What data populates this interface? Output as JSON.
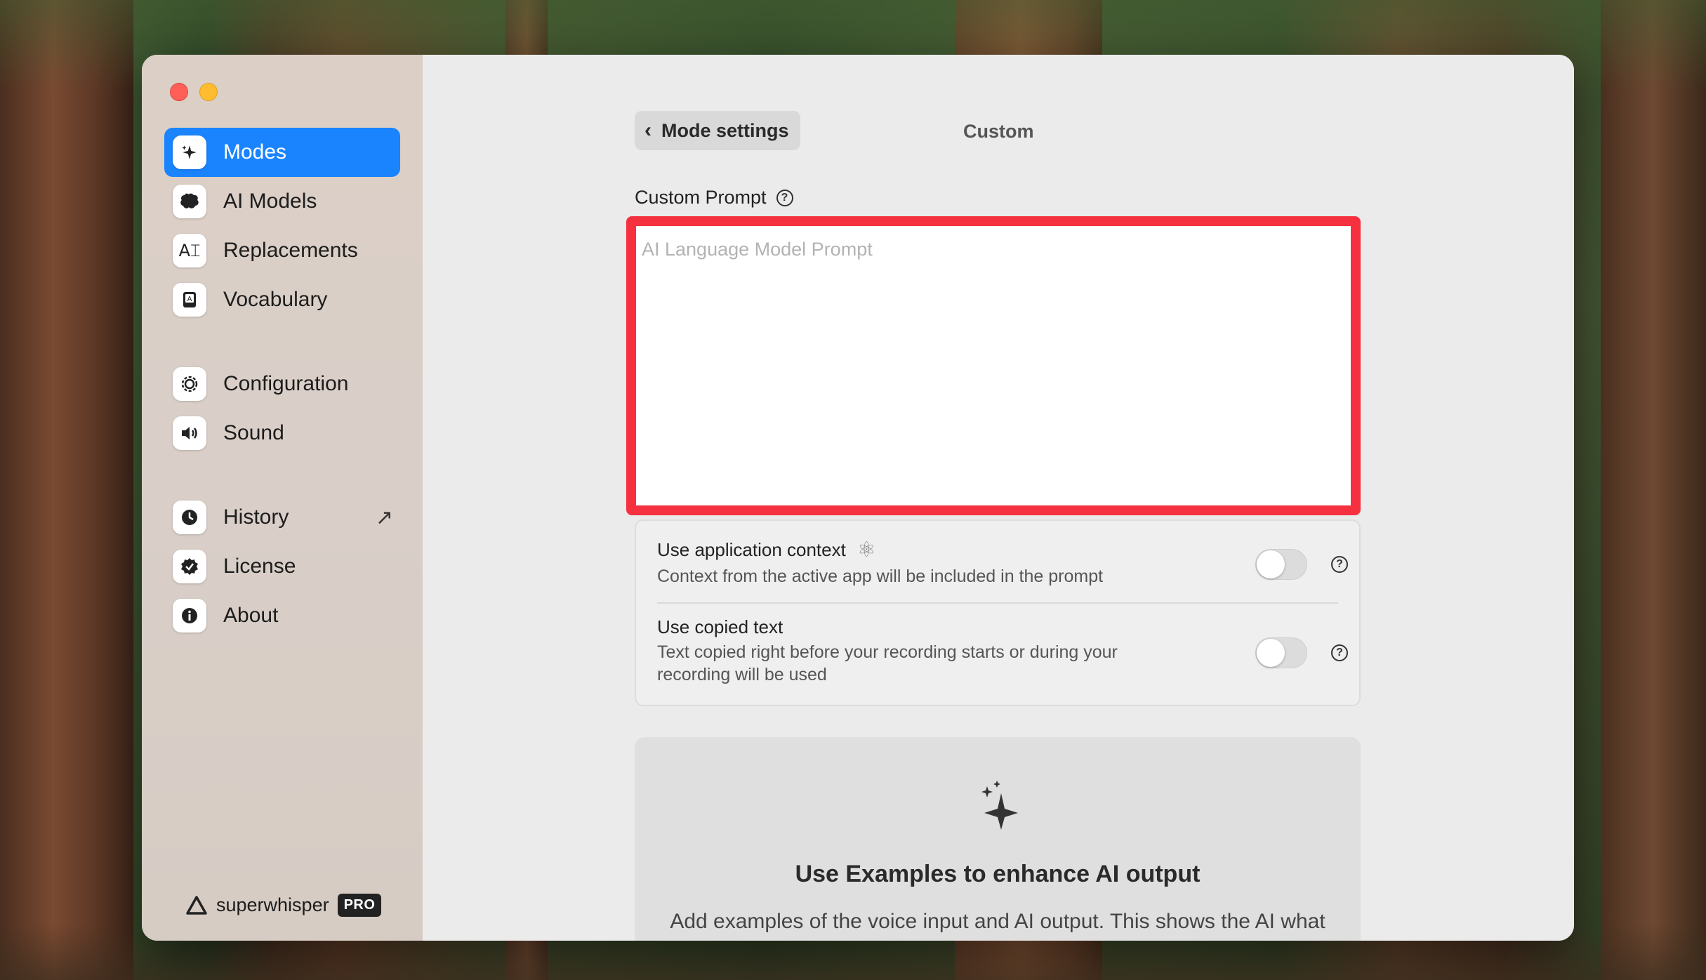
{
  "window": {
    "traffic_lights": [
      "close",
      "minimize"
    ]
  },
  "sidebar": {
    "items": [
      {
        "label": "Modes",
        "icon": "sparkle-icon",
        "active": true
      },
      {
        "label": "AI Models",
        "icon": "brain-icon"
      },
      {
        "label": "Replacements",
        "icon": "text-cursor-icon"
      },
      {
        "label": "Vocabulary",
        "icon": "book-icon"
      },
      {
        "label": "Configuration",
        "icon": "gear-icon"
      },
      {
        "label": "Sound",
        "icon": "speaker-icon"
      },
      {
        "label": "History",
        "icon": "history-icon",
        "external": true
      },
      {
        "label": "License",
        "icon": "badge-check-icon"
      },
      {
        "label": "About",
        "icon": "info-icon"
      }
    ],
    "brand": {
      "name": "superwhisper",
      "badge": "PRO"
    }
  },
  "header": {
    "back_label": "Mode settings",
    "mode_name": "Custom"
  },
  "custom_prompt": {
    "label": "Custom Prompt",
    "placeholder": "AI Language Model Prompt",
    "value": ""
  },
  "options": {
    "app_context": {
      "title": "Use application context",
      "description": "Context from the active app will be included in the prompt",
      "enabled": false
    },
    "copied_text": {
      "title": "Use copied text",
      "description": "Text copied right before your recording starts or during your recording will be used",
      "enabled": false
    }
  },
  "examples": {
    "title": "Use Examples to enhance AI output",
    "description": "Add examples of the voice input and AI output. This shows the AI what"
  },
  "colors": {
    "accent": "#1a84ff",
    "highlight_border": "#f5303f"
  }
}
